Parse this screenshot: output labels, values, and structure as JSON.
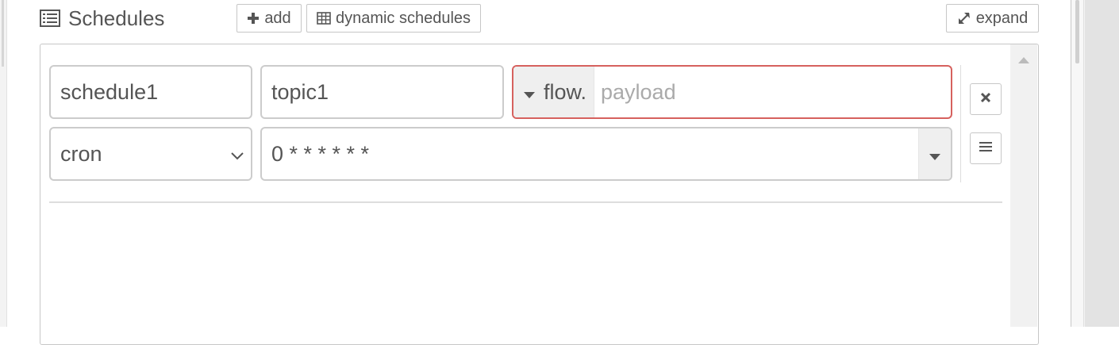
{
  "header": {
    "title": "Schedules",
    "icon": "list-alt-icon",
    "buttons": {
      "add": {
        "label": "add",
        "icon": "plus-icon"
      },
      "dynamic": {
        "label": "dynamic schedules",
        "icon": "table-icon"
      },
      "expand": {
        "label": "expand",
        "icon": "expand-icon"
      }
    }
  },
  "schedule": {
    "name": "schedule1",
    "topic": "topic1",
    "payload": {
      "type_label": "flow.",
      "placeholder": "payload",
      "invalid": true
    },
    "kind": {
      "selected": "cron"
    },
    "expression": "0 * * * * * *"
  },
  "colors": {
    "error_border": "#d6615e",
    "text": "#555555",
    "placeholder": "#aaaaaa",
    "border": "#cccccc"
  }
}
